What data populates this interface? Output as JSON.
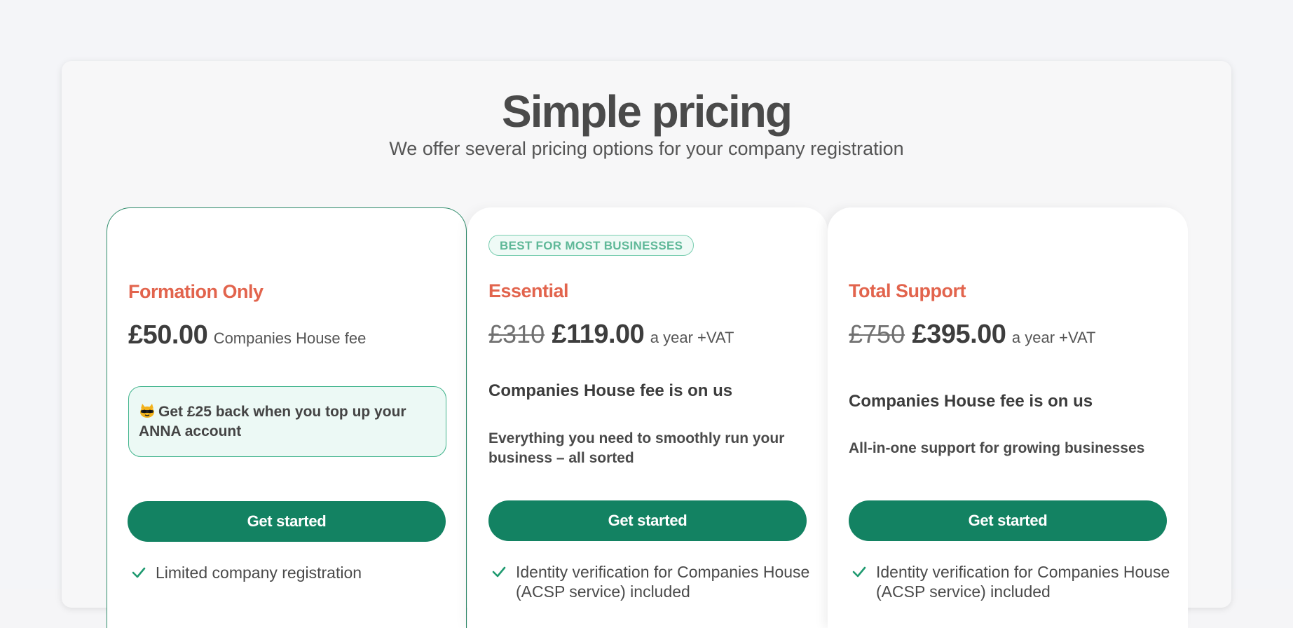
{
  "header": {
    "title": "Simple pricing",
    "subtitle": "We offer several pricing options for your company registration"
  },
  "plans": [
    {
      "name": "Formation Only",
      "price": "£50.00",
      "price_note": "Companies House fee",
      "promo": "Get £25 back when you top up your ANNA account",
      "promo_icon": "cat-face-icon",
      "cta": "Get started",
      "feature": "Limited company registration"
    },
    {
      "badge": "BEST FOR MOST BUSINESSES",
      "name": "Essential",
      "old_price": "£310",
      "price": "£119.00",
      "price_note": "a year +VAT",
      "fee_note": "Companies House fee is on us",
      "description": "Everything you need to smoothly run your business – all sorted",
      "cta": "Get started",
      "feature": "Identity verification for Companies House (ACSP service) included"
    },
    {
      "name": "Total Support",
      "old_price": "£750",
      "price": "£395.00",
      "price_note": "a year +VAT",
      "fee_note": "Companies House fee is on us",
      "description": "All-in-one support for growing businesses",
      "cta": "Get started",
      "feature": "Identity verification for Companies House (ACSP service) included"
    }
  ],
  "colors": {
    "accent": "#138262",
    "plan_name": "#e2644d",
    "badge_text": "#5fb898",
    "promo_bg": "#ecf9f5"
  }
}
